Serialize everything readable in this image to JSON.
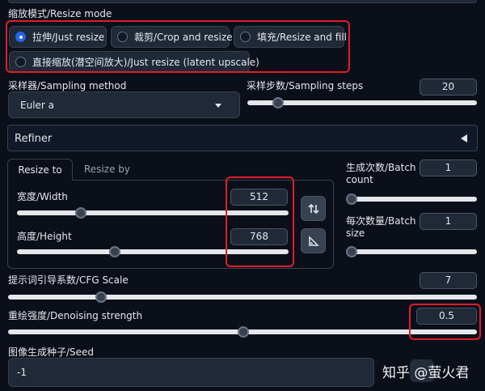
{
  "resize_mode": {
    "label": "缩放模式/Resize mode",
    "options": [
      {
        "label": "拉伸/Just resize",
        "checked": true
      },
      {
        "label": "裁剪/Crop and resize",
        "checked": false
      },
      {
        "label": "填充/Resize and fill",
        "checked": false
      },
      {
        "label": "直接缩放(潜空间放大)/Just resize (latent upscale)",
        "checked": false
      }
    ]
  },
  "sampling_method": {
    "label": "采样器/Sampling method",
    "value": "Euler a"
  },
  "sampling_steps": {
    "label": "采样步数/Sampling steps",
    "value": "20",
    "fraction": 0.2
  },
  "refiner": {
    "label": "Refiner"
  },
  "size_tabs": {
    "active": "Resize to",
    "inactive": "Resize by"
  },
  "width": {
    "label": "宽度/Width",
    "value": "512",
    "fraction": 0.23
  },
  "height": {
    "label": "高度/Height",
    "value": "768",
    "fraction": 0.35
  },
  "batch_count": {
    "label_line1": "生成次数/Batch",
    "label_line2": "count",
    "value": "1",
    "fraction": 0.0
  },
  "batch_size": {
    "label_line1": "每次数量/Batch",
    "label_line2": "size",
    "value": "1",
    "fraction": 0.0
  },
  "cfg_scale": {
    "label": "提示词引导系数/CFG Scale",
    "value": "7",
    "fraction": 0.2
  },
  "denoising": {
    "label": "重绘强度/Denoising strength",
    "value": "0.5",
    "fraction": 0.5
  },
  "seed": {
    "label": "图像生成种子/Seed",
    "value": "-1"
  },
  "watermark": {
    "text": "知乎 @萤火君"
  },
  "icons": {
    "swap": "swap-arrows-icon",
    "ratio": "aspect-ratio-icon"
  },
  "colors": {
    "accent": "#2563eb",
    "highlight": "#e11d2a",
    "background": "#0b0f19"
  }
}
